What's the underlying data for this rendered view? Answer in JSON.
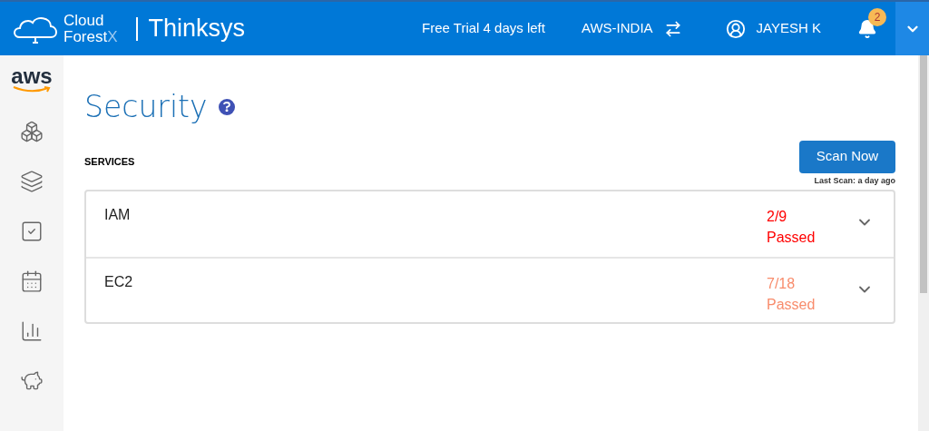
{
  "header": {
    "logo_line1": "Cloud",
    "logo_line2": "Forest",
    "logo_mark": "X",
    "company": "Thinksys",
    "trial": "Free Trial 4 days left",
    "account": "AWS-INDIA",
    "user": "JAYESH K",
    "notifications": "2"
  },
  "sidebar": {
    "provider": "aws"
  },
  "page": {
    "title": "Security",
    "section": "SERVICES",
    "scan_button": "Scan Now",
    "last_scan": "Last Scan: a day ago"
  },
  "services": [
    {
      "name": "IAM",
      "score": "2/9",
      "status": "Passed",
      "color": "#ff0000"
    },
    {
      "name": "EC2",
      "score": "7/18",
      "status": "Passed",
      "color": "#f88c6c"
    }
  ]
}
